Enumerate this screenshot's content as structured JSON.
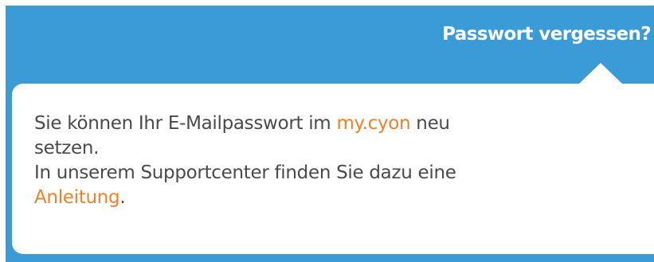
{
  "header": {
    "forgot_password_link": "Passwort vergessen?"
  },
  "tooltip": {
    "line1_before": "Sie können Ihr E-Mailpasswort im ",
    "portal_link": "my.cyon",
    "line1_after": " neu",
    "line2": "setzen.",
    "line3": "In unserem Supportcenter finden Sie dazu eine",
    "guide_link": "Anleitung",
    "guide_suffix": "."
  },
  "colors": {
    "header_background": "#3a9bd6",
    "link_accent": "#f0812a",
    "body_text": "#4a4a4a"
  }
}
